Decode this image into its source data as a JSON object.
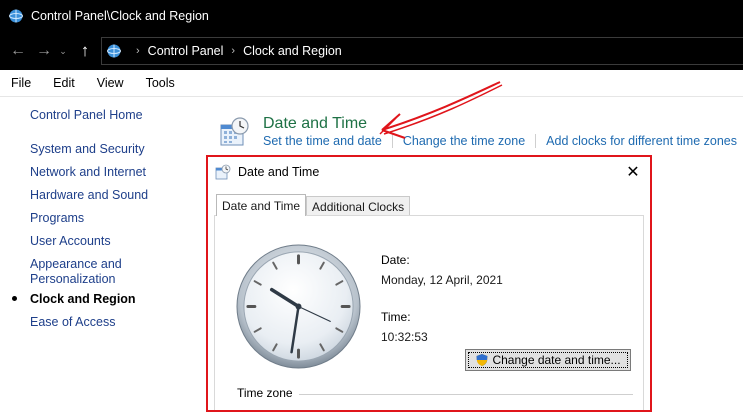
{
  "window": {
    "title": "Control Panel\\Clock and Region"
  },
  "nav": {
    "breadcrumbs": [
      "Control Panel",
      "Clock and Region"
    ]
  },
  "menu": {
    "items": [
      "File",
      "Edit",
      "View",
      "Tools"
    ]
  },
  "sidebar": {
    "home": "Control Panel Home",
    "items": [
      "System and Security",
      "Network and Internet",
      "Hardware and Sound",
      "Programs",
      "User Accounts",
      "Appearance and",
      "Personalization",
      "Clock and Region",
      "Ease of Access"
    ],
    "active": "Clock and Region"
  },
  "main": {
    "title": "Date and Time",
    "links": [
      "Set the time and date",
      "Change the time zone",
      "Add clocks for different time zones"
    ]
  },
  "dialog": {
    "title": "Date and Time",
    "tabs": [
      "Date and Time",
      "Additional Clocks"
    ],
    "date_label": "Date:",
    "date_value": "Monday, 12 April, 2021",
    "time_label": "Time:",
    "time_value": "10:32:53",
    "button_label": "Change date and time...",
    "timezone_label": "Time zone"
  },
  "colors": {
    "accent_green": "#1e7145",
    "link_blue": "#1e6ab0",
    "annotation_red": "#e0151b"
  }
}
